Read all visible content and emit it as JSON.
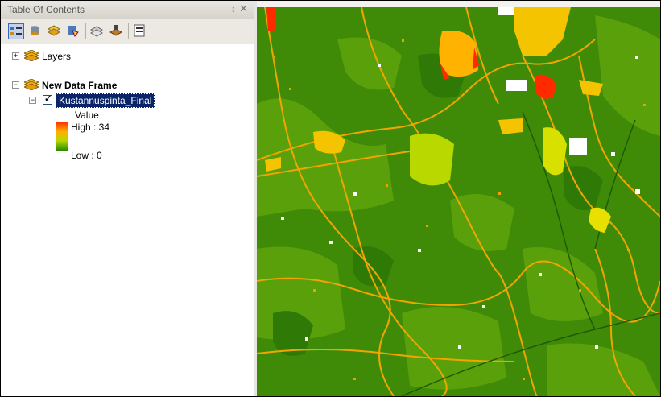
{
  "toc": {
    "title": "Table Of Contents",
    "pin_glyph": "↕",
    "close_glyph": "✕",
    "toolbar": [
      {
        "icon": "list-by-drawing-order-icon",
        "active": true
      },
      {
        "icon": "list-by-source-icon",
        "active": false
      },
      {
        "icon": "list-by-visibility-icon",
        "active": false
      },
      {
        "icon": "list-by-selection-icon",
        "active": false
      },
      {
        "icon": "layers-options-icon",
        "active": false
      },
      {
        "icon": "toggle-layers-icon",
        "active": false
      },
      {
        "icon": "options-icon",
        "active": false
      }
    ]
  },
  "tree": {
    "layers_label": "Layers",
    "frame_label": "New Data Frame",
    "layer_name": "Kustannuspinta_Final",
    "layer_checked": true,
    "legend": {
      "title": "Value",
      "high_label": "High : 34",
      "low_label": "Low : 0"
    }
  },
  "colors": {
    "map_base": "#3f8b08",
    "map_light": "#5aa00a",
    "road": "#f2a500",
    "urban": "#ffb300",
    "high": "#ff2a00",
    "selection": "#0a246a"
  }
}
